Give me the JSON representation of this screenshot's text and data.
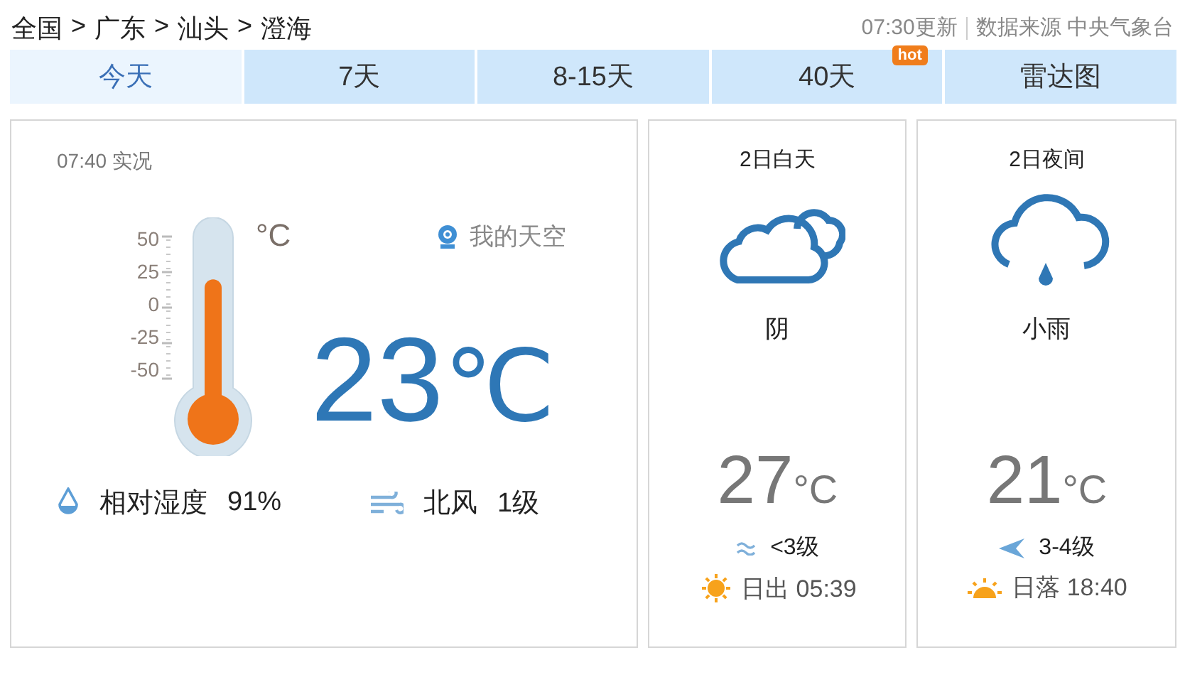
{
  "breadcrumb": {
    "items": [
      "全国",
      "广东",
      "汕头",
      "澄海"
    ],
    "separator": ">"
  },
  "update": {
    "time": "07:30更新",
    "source": "数据来源 中央气象台"
  },
  "tabs": [
    {
      "label": "今天",
      "selected": true
    },
    {
      "label": "7天",
      "selected": false
    },
    {
      "label": "8-15天",
      "selected": false
    },
    {
      "label": "40天",
      "selected": false,
      "badge": "hot"
    },
    {
      "label": "雷达图",
      "selected": false
    }
  ],
  "current": {
    "observed": "07:40 实况",
    "my_sky": "我的天空",
    "scale": [
      "50",
      "25",
      "0",
      "-25",
      "-50"
    ],
    "scale_unit": "°C",
    "temperature": "23",
    "unit": "℃",
    "humidity_label": "相对湿度",
    "humidity": "91%",
    "wind_direction": "北风",
    "wind_level": "1级"
  },
  "forecasts": [
    {
      "kind": "day",
      "title": "2日白天",
      "weather": "阴",
      "temperature": "27",
      "unit": "°C",
      "wind": "<3级",
      "sun": "日出 05:39"
    },
    {
      "kind": "night",
      "title": "2日夜间",
      "weather": "小雨",
      "temperature": "21",
      "unit": "°C",
      "wind": "3-4级",
      "sun": "日落 18:40"
    }
  ]
}
